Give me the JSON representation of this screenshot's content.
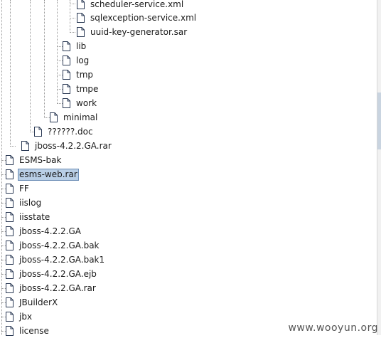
{
  "tree": {
    "nodes": [
      {
        "label": "scheduler-service.xml"
      },
      {
        "label": "sqlexception-service.xml"
      },
      {
        "label": "uuid-key-generator.sar"
      },
      {
        "label": "lib"
      },
      {
        "label": "log"
      },
      {
        "label": "tmp"
      },
      {
        "label": "tmpe"
      },
      {
        "label": "work"
      },
      {
        "label": "minimal"
      },
      {
        "label": "??????.doc"
      },
      {
        "label": "jboss-4.2.2.GA.rar"
      },
      {
        "label": "ESMS-bak"
      },
      {
        "label": "esms-web.rar",
        "selected": true
      },
      {
        "label": "FF"
      },
      {
        "label": "iislog"
      },
      {
        "label": "iisstate"
      },
      {
        "label": "jboss-4.2.2.GA"
      },
      {
        "label": "jboss-4.2.2.GA.bak"
      },
      {
        "label": "jboss-4.2.2.GA.bak1"
      },
      {
        "label": "jboss-4.2.2.GA.ejb"
      },
      {
        "label": "jboss-4.2.2.GA.rar"
      },
      {
        "label": "JBuilderX"
      },
      {
        "label": "jbx"
      },
      {
        "label": "license"
      }
    ]
  },
  "watermark": "www.wooyun.org"
}
